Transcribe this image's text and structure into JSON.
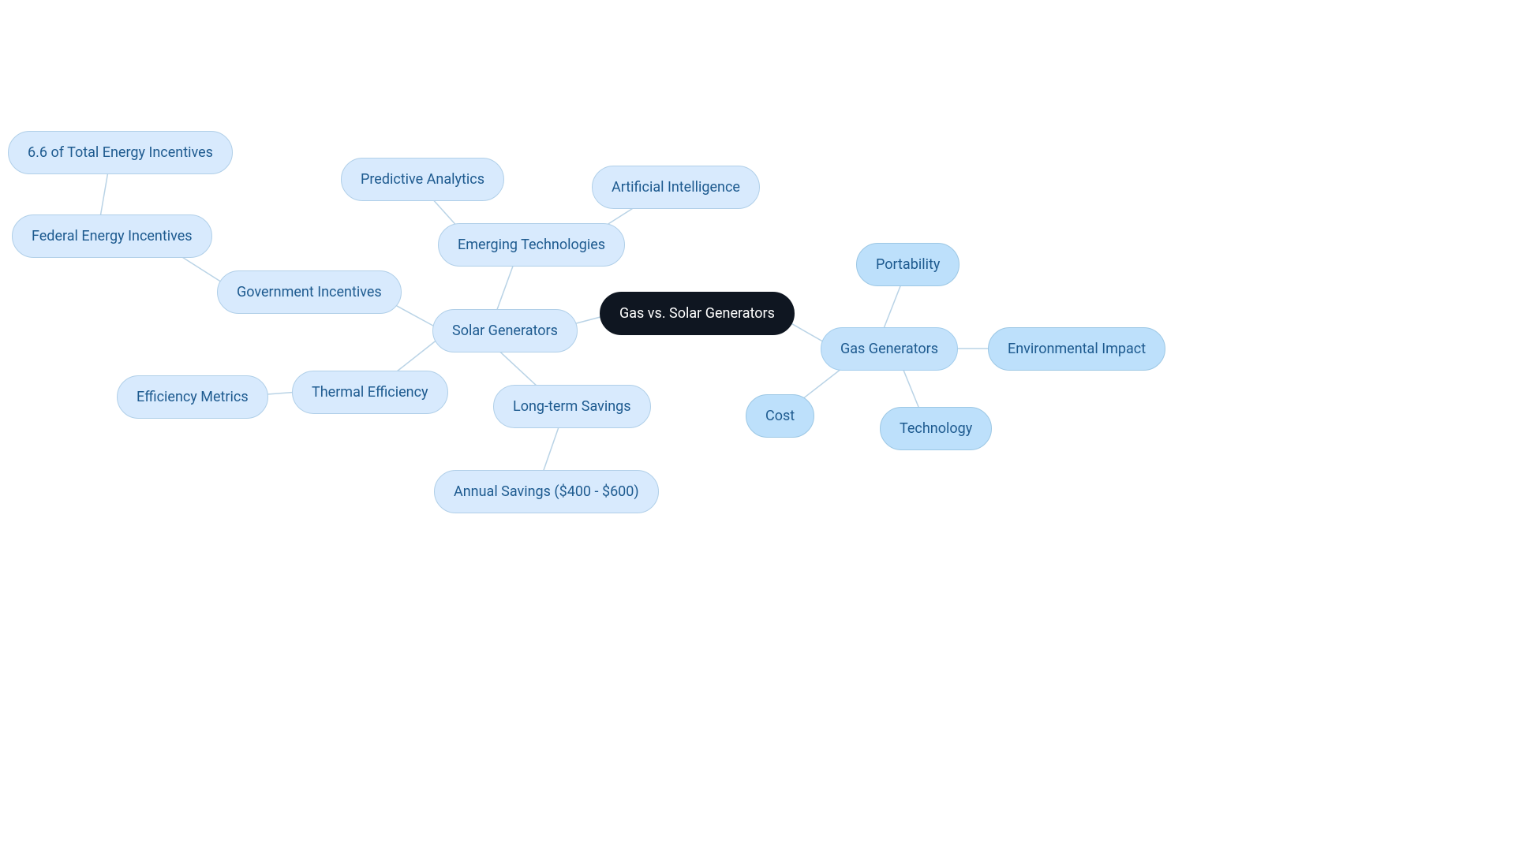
{
  "root": {
    "label": "Gas vs. Solar Generators"
  },
  "gas": {
    "label": "Gas Generators",
    "children": {
      "portability": "Portability",
      "env": "Environmental Impact",
      "tech": "Technology",
      "cost": "Cost"
    }
  },
  "solar": {
    "label": "Solar Generators",
    "emerging": {
      "label": "Emerging Technologies",
      "children": {
        "predictive": "Predictive Analytics",
        "ai": "Artificial Intelligence"
      }
    },
    "gov": {
      "label": "Government Incentives",
      "federal": {
        "label": "Federal Energy Incentives",
        "children": {
          "share": "6.6 of Total Energy Incentives"
        }
      }
    },
    "thermal": {
      "label": "Thermal Efficiency",
      "children": {
        "metrics": "Efficiency Metrics"
      }
    },
    "longterm": {
      "label": "Long-term Savings",
      "children": {
        "annual": "Annual Savings ($400 - $600)"
      }
    }
  }
}
